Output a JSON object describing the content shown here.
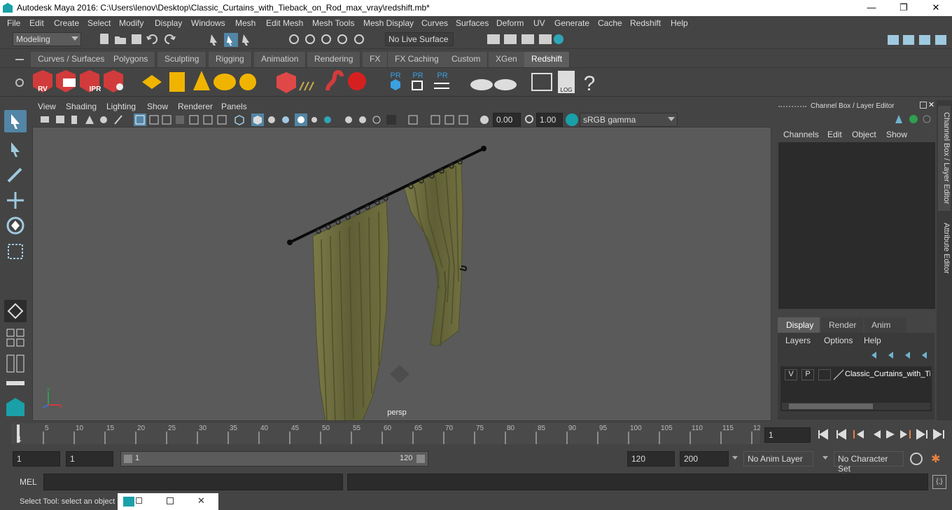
{
  "window": {
    "title": "Autodesk Maya 2016: C:\\Users\\lenov\\Desktop\\Classic_Curtains_with_Tieback_on_Rod_max_vray\\redshift.mb*",
    "minimize": "—",
    "maximize": "❐",
    "close": "✕"
  },
  "menubar": [
    "File",
    "Edit",
    "Create",
    "Select",
    "Modify",
    "Display",
    "Windows",
    "Mesh",
    "Edit Mesh",
    "Mesh Tools",
    "Mesh Display",
    "Curves",
    "Surfaces",
    "Deform",
    "UV",
    "Generate",
    "Cache",
    "Redshift",
    "Help"
  ],
  "statusline": {
    "mode": "Modeling",
    "live_surface": "No Live Surface"
  },
  "shelf_tabs": [
    "Curves / Surfaces",
    "Polygons",
    "Sculpting",
    "Rigging",
    "Animation",
    "Rendering",
    "FX",
    "FX Caching",
    "Custom",
    "XGen",
    "Redshift"
  ],
  "active_shelf_tab": "Redshift",
  "shelf": {
    "rv_label": "RV",
    "ipr_label": "IPR",
    "pr_labels": [
      "PR",
      "PR",
      "PR"
    ],
    "log_label": "LOG",
    "help": "?"
  },
  "viewport_menu": [
    "View",
    "Shading",
    "Lighting",
    "Show",
    "Renderer",
    "Panels"
  ],
  "viewport_toolbar": {
    "exposure": "0.00",
    "gamma": "1.00",
    "color_space": "sRGB gamma"
  },
  "viewport": {
    "camera_label": "persp",
    "axis_y": "y",
    "axis_x": "x"
  },
  "channel_box": {
    "title": "Channel Box / Layer Editor",
    "menu": [
      "Channels",
      "Edit",
      "Object",
      "Show"
    ]
  },
  "layer_editor": {
    "tabs": [
      "Display",
      "Render",
      "Anim"
    ],
    "active_tab": "Display",
    "menu": [
      "Layers",
      "Options",
      "Help"
    ],
    "layer": {
      "v": "V",
      "p": "P",
      "name": "Classic_Curtains_with_Ti"
    }
  },
  "side_tabs": [
    "Channel Box / Layer Editor",
    "Attribute Editor"
  ],
  "timeline": {
    "ticks": [
      "5",
      "10",
      "15",
      "20",
      "25",
      "30",
      "35",
      "40",
      "45",
      "50",
      "55",
      "60",
      "65",
      "70",
      "75",
      "80",
      "85",
      "90",
      "95",
      "100",
      "105",
      "110",
      "115",
      "12"
    ],
    "current_frame_marker": "1",
    "current_frame": "1"
  },
  "range": {
    "start": "1",
    "playback_start": "1",
    "slider_start": "1",
    "slider_end": "120",
    "playback_end": "120",
    "end": "200",
    "anim_layer": "No Anim Layer",
    "character_set": "No Character Set"
  },
  "cmdline": {
    "label": "MEL"
  },
  "help_line": "Select Tool: select an object",
  "colors": {
    "accent": "#5285a6",
    "curtain": "#6b6b3e",
    "background": "#444444",
    "viewport": "#5a5a5a"
  }
}
